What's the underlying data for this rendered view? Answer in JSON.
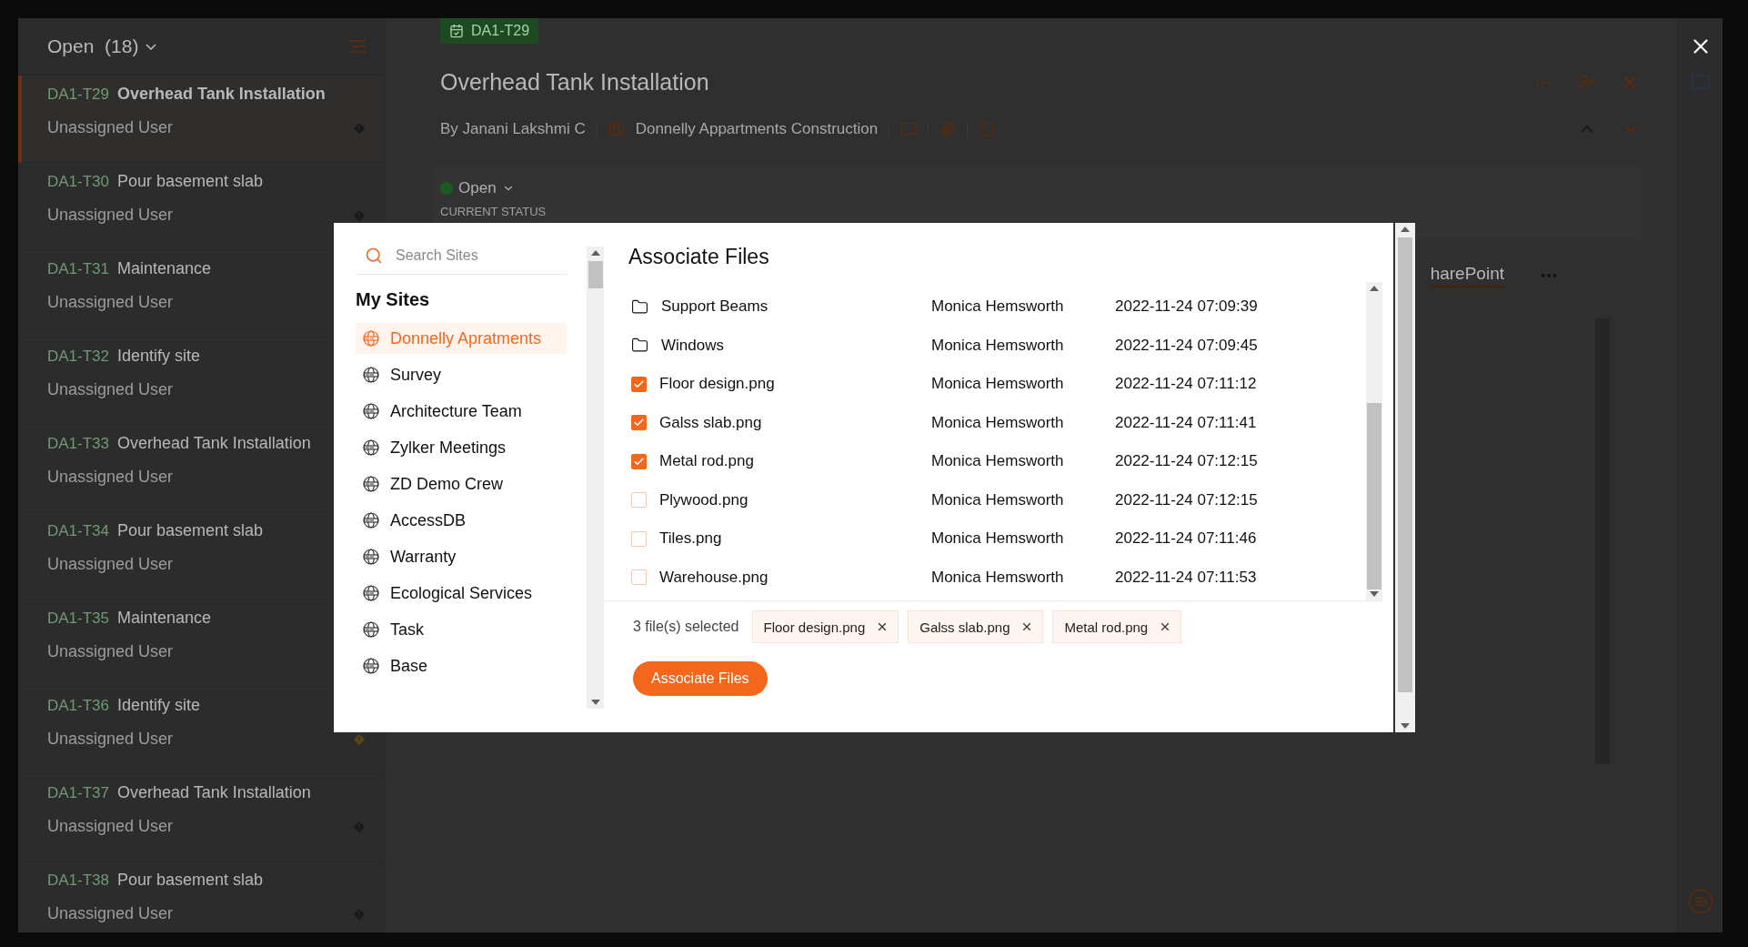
{
  "list_header": {
    "title": "Open",
    "count": "(18)"
  },
  "tasks": [
    {
      "id": "DA1-T29",
      "title": "Overhead Tank Installation",
      "assignee": "Unassigned User",
      "selected": true,
      "flagged": true,
      "color": "#1a1a1a"
    },
    {
      "id": "DA1-T30",
      "title": "Pour basement slab",
      "assignee": "Unassigned User",
      "selected": false,
      "flagged": true,
      "color": "#1a1a1a"
    },
    {
      "id": "DA1-T31",
      "title": "Maintenance",
      "assignee": "Unassigned User",
      "selected": false
    },
    {
      "id": "DA1-T32",
      "title": "Identify site",
      "assignee": "Unassigned User",
      "selected": false
    },
    {
      "id": "DA1-T33",
      "title": "Overhead Tank Installation",
      "assignee": "Unassigned User",
      "selected": false
    },
    {
      "id": "DA1-T34",
      "title": "Pour basement slab",
      "assignee": "Unassigned User",
      "selected": false
    },
    {
      "id": "DA1-T35",
      "title": "Maintenance",
      "assignee": "Unassigned User",
      "selected": false
    },
    {
      "id": "DA1-T36",
      "title": "Identify site",
      "assignee": "Unassigned User",
      "selected": false,
      "flagged": true,
      "color": "#5e4610"
    },
    {
      "id": "DA1-T37",
      "title": "Overhead Tank Installation",
      "assignee": "Unassigned User",
      "selected": false,
      "flagged": true,
      "color": "#1a1a1a"
    },
    {
      "id": "DA1-T38",
      "title": "Pour basement slab",
      "assignee": "Unassigned User",
      "selected": false,
      "flagged": true,
      "color": "#1a1a1a"
    }
  ],
  "detail": {
    "tag": "DA1-T29",
    "title": "Overhead Tank Installation",
    "author": "By Janani Lakshmi C",
    "project": "Donnelly Appartments Construction",
    "status": "Open",
    "status_label": "CURRENT STATUS",
    "tab": "harePoint"
  },
  "modal": {
    "search": {
      "placeholder": "Search Sites"
    },
    "sites_heading": "My Sites",
    "sites": [
      {
        "name": "Donnelly Apratments",
        "selected": true
      },
      {
        "name": "Survey",
        "selected": false
      },
      {
        "name": "Architecture Team",
        "selected": false
      },
      {
        "name": "Zylker Meetings",
        "selected": false
      },
      {
        "name": "ZD Demo Crew",
        "selected": false
      },
      {
        "name": "AccessDB",
        "selected": false
      },
      {
        "name": "Warranty",
        "selected": false
      },
      {
        "name": "Ecological Services",
        "selected": false
      },
      {
        "name": "Task",
        "selected": false
      },
      {
        "name": "Base",
        "selected": false
      }
    ],
    "title": "Associate Files",
    "files": [
      {
        "kind": "folder",
        "name": "Support Beams",
        "owner": "Monica Hemsworth",
        "modified": "2022-11-24 07:09:39"
      },
      {
        "kind": "folder",
        "name": "Windows",
        "owner": "Monica Hemsworth",
        "modified": "2022-11-24 07:09:45"
      },
      {
        "kind": "file",
        "name": "Floor design.png",
        "owner": "Monica Hemsworth",
        "modified": "2022-11-24 07:11:12",
        "checked": true
      },
      {
        "kind": "file",
        "name": "Galss slab.png",
        "owner": "Monica Hemsworth",
        "modified": "2022-11-24 07:11:41",
        "checked": true
      },
      {
        "kind": "file",
        "name": "Metal rod.png",
        "owner": "Monica Hemsworth",
        "modified": "2022-11-24 07:12:15",
        "checked": true
      },
      {
        "kind": "file",
        "name": "Plywood.png",
        "owner": "Monica Hemsworth",
        "modified": "2022-11-24 07:12:15",
        "checked": false
      },
      {
        "kind": "file",
        "name": "Tiles.png",
        "owner": "Monica Hemsworth",
        "modified": "2022-11-24 07:11:46",
        "checked": false
      },
      {
        "kind": "file",
        "name": "Warehouse.png",
        "owner": "Monica Hemsworth",
        "modified": "2022-11-24 07:11:53",
        "checked": false
      }
    ],
    "summary": "3 file(s) selected",
    "chips": [
      "Floor design.png",
      "Galss slab.png",
      "Metal rod.png"
    ],
    "button": "Associate Files"
  }
}
